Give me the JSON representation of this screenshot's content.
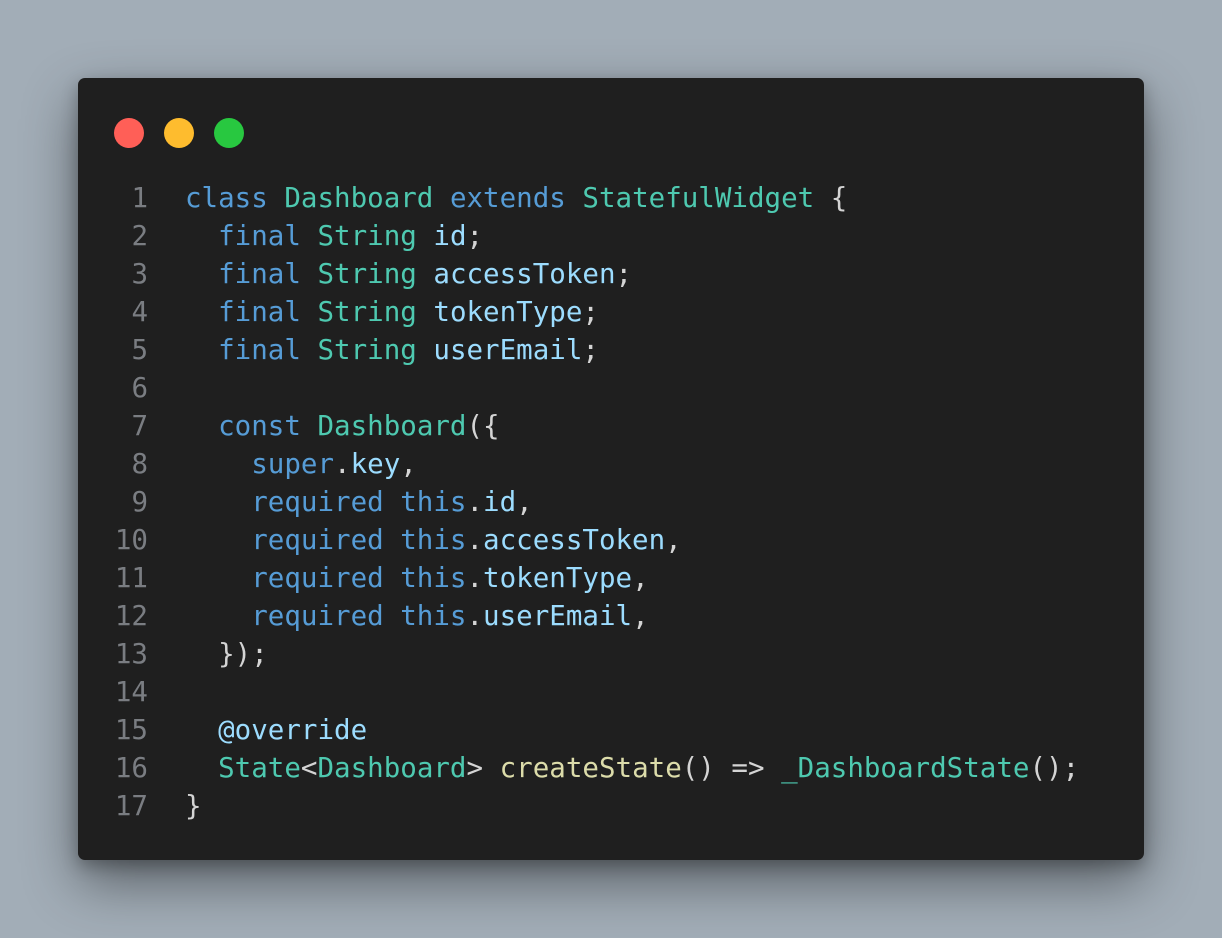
{
  "window": {
    "controls": [
      {
        "name": "close",
        "color": "#ff5f57"
      },
      {
        "name": "minimize",
        "color": "#febc2e"
      },
      {
        "name": "maximize",
        "color": "#28c840"
      }
    ]
  },
  "code": {
    "lines": [
      {
        "num": "1",
        "tokens": [
          {
            "text": "class",
            "kind": "keyword"
          },
          {
            "text": " ",
            "kind": "punct"
          },
          {
            "text": "Dashboard",
            "kind": "type"
          },
          {
            "text": " ",
            "kind": "punct"
          },
          {
            "text": "extends",
            "kind": "keyword"
          },
          {
            "text": " ",
            "kind": "punct"
          },
          {
            "text": "StatefulWidget",
            "kind": "type"
          },
          {
            "text": " {",
            "kind": "punct"
          }
        ]
      },
      {
        "num": "2",
        "tokens": [
          {
            "text": "  ",
            "kind": "punct"
          },
          {
            "text": "final",
            "kind": "keyword"
          },
          {
            "text": " ",
            "kind": "punct"
          },
          {
            "text": "String",
            "kind": "type"
          },
          {
            "text": " ",
            "kind": "punct"
          },
          {
            "text": "id",
            "kind": "ident"
          },
          {
            "text": ";",
            "kind": "punct"
          }
        ]
      },
      {
        "num": "3",
        "tokens": [
          {
            "text": "  ",
            "kind": "punct"
          },
          {
            "text": "final",
            "kind": "keyword"
          },
          {
            "text": " ",
            "kind": "punct"
          },
          {
            "text": "String",
            "kind": "type"
          },
          {
            "text": " ",
            "kind": "punct"
          },
          {
            "text": "accessToken",
            "kind": "ident"
          },
          {
            "text": ";",
            "kind": "punct"
          }
        ]
      },
      {
        "num": "4",
        "tokens": [
          {
            "text": "  ",
            "kind": "punct"
          },
          {
            "text": "final",
            "kind": "keyword"
          },
          {
            "text": " ",
            "kind": "punct"
          },
          {
            "text": "String",
            "kind": "type"
          },
          {
            "text": " ",
            "kind": "punct"
          },
          {
            "text": "tokenType",
            "kind": "ident"
          },
          {
            "text": ";",
            "kind": "punct"
          }
        ]
      },
      {
        "num": "5",
        "tokens": [
          {
            "text": "  ",
            "kind": "punct"
          },
          {
            "text": "final",
            "kind": "keyword"
          },
          {
            "text": " ",
            "kind": "punct"
          },
          {
            "text": "String",
            "kind": "type"
          },
          {
            "text": " ",
            "kind": "punct"
          },
          {
            "text": "userEmail",
            "kind": "ident"
          },
          {
            "text": ";",
            "kind": "punct"
          }
        ]
      },
      {
        "num": "6",
        "tokens": []
      },
      {
        "num": "7",
        "tokens": [
          {
            "text": "  ",
            "kind": "punct"
          },
          {
            "text": "const",
            "kind": "keyword"
          },
          {
            "text": " ",
            "kind": "punct"
          },
          {
            "text": "Dashboard",
            "kind": "type"
          },
          {
            "text": "({",
            "kind": "punct"
          }
        ]
      },
      {
        "num": "8",
        "tokens": [
          {
            "text": "    ",
            "kind": "punct"
          },
          {
            "text": "super",
            "kind": "keyword"
          },
          {
            "text": ".",
            "kind": "punct"
          },
          {
            "text": "key",
            "kind": "ident"
          },
          {
            "text": ",",
            "kind": "punct"
          }
        ]
      },
      {
        "num": "9",
        "tokens": [
          {
            "text": "    ",
            "kind": "punct"
          },
          {
            "text": "required",
            "kind": "keyword"
          },
          {
            "text": " ",
            "kind": "punct"
          },
          {
            "text": "this",
            "kind": "keyword"
          },
          {
            "text": ".",
            "kind": "punct"
          },
          {
            "text": "id",
            "kind": "ident"
          },
          {
            "text": ",",
            "kind": "punct"
          }
        ]
      },
      {
        "num": "10",
        "tokens": [
          {
            "text": "    ",
            "kind": "punct"
          },
          {
            "text": "required",
            "kind": "keyword"
          },
          {
            "text": " ",
            "kind": "punct"
          },
          {
            "text": "this",
            "kind": "keyword"
          },
          {
            "text": ".",
            "kind": "punct"
          },
          {
            "text": "accessToken",
            "kind": "ident"
          },
          {
            "text": ",",
            "kind": "punct"
          }
        ]
      },
      {
        "num": "11",
        "tokens": [
          {
            "text": "    ",
            "kind": "punct"
          },
          {
            "text": "required",
            "kind": "keyword"
          },
          {
            "text": " ",
            "kind": "punct"
          },
          {
            "text": "this",
            "kind": "keyword"
          },
          {
            "text": ".",
            "kind": "punct"
          },
          {
            "text": "tokenType",
            "kind": "ident"
          },
          {
            "text": ",",
            "kind": "punct"
          }
        ]
      },
      {
        "num": "12",
        "tokens": [
          {
            "text": "    ",
            "kind": "punct"
          },
          {
            "text": "required",
            "kind": "keyword"
          },
          {
            "text": " ",
            "kind": "punct"
          },
          {
            "text": "this",
            "kind": "keyword"
          },
          {
            "text": ".",
            "kind": "punct"
          },
          {
            "text": "userEmail",
            "kind": "ident"
          },
          {
            "text": ",",
            "kind": "punct"
          }
        ]
      },
      {
        "num": "13",
        "tokens": [
          {
            "text": "  });",
            "kind": "punct"
          }
        ]
      },
      {
        "num": "14",
        "tokens": []
      },
      {
        "num": "15",
        "tokens": [
          {
            "text": "  ",
            "kind": "punct"
          },
          {
            "text": "@override",
            "kind": "ident"
          }
        ]
      },
      {
        "num": "16",
        "tokens": [
          {
            "text": "  ",
            "kind": "punct"
          },
          {
            "text": "State",
            "kind": "type"
          },
          {
            "text": "<",
            "kind": "punct"
          },
          {
            "text": "Dashboard",
            "kind": "type"
          },
          {
            "text": "> ",
            "kind": "punct"
          },
          {
            "text": "createState",
            "kind": "func"
          },
          {
            "text": "() => ",
            "kind": "punct"
          },
          {
            "text": "_DashboardState",
            "kind": "type"
          },
          {
            "text": "();",
            "kind": "punct"
          }
        ]
      },
      {
        "num": "17",
        "tokens": [
          {
            "text": "}",
            "kind": "punct"
          }
        ]
      }
    ]
  }
}
